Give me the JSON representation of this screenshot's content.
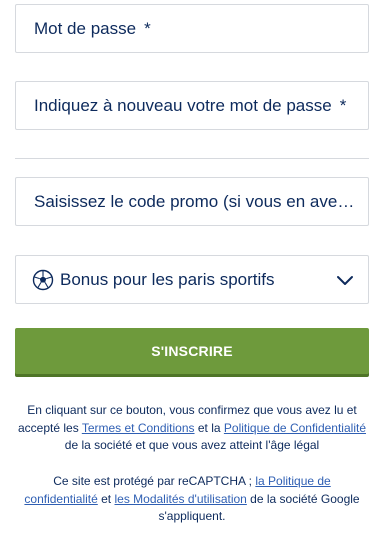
{
  "form": {
    "password": {
      "placeholder": "Mot de passe",
      "required_mark": "*"
    },
    "password_confirm": {
      "placeholder": "Indiquez à nouveau votre mot de passe",
      "required_mark": "*"
    },
    "promo": {
      "placeholder": "Saisissez le code promo (si vous en avez u…"
    },
    "bonus": {
      "label": "Bonus pour les paris sportifs",
      "icon": "soccer-ball-icon",
      "chevron": "chevron-down-icon"
    }
  },
  "submit": {
    "label": "S'INSCRIRE",
    "color": "#6e9a3c"
  },
  "legal1": {
    "t1": "En cliquant sur ce bouton, vous confirmez que vous avez lu et accepté les ",
    "link1": "Termes et Conditions",
    "t2": " et la ",
    "link2": "Politique de Confidentialité",
    "t3": " de la société et que vous avez atteint l'âge légal"
  },
  "legal2": {
    "t1": "Ce site est protégé par reCAPTCHA ; ",
    "link1": "la Politique de confidentialité",
    "t2": " et ",
    "link2": "les Modalités d'utilisation",
    "t3": " de la société Google s'appliquent."
  },
  "colors": {
    "text": "#0d2a5c",
    "link": "#2f5fb3",
    "border": "#d6d9de"
  }
}
